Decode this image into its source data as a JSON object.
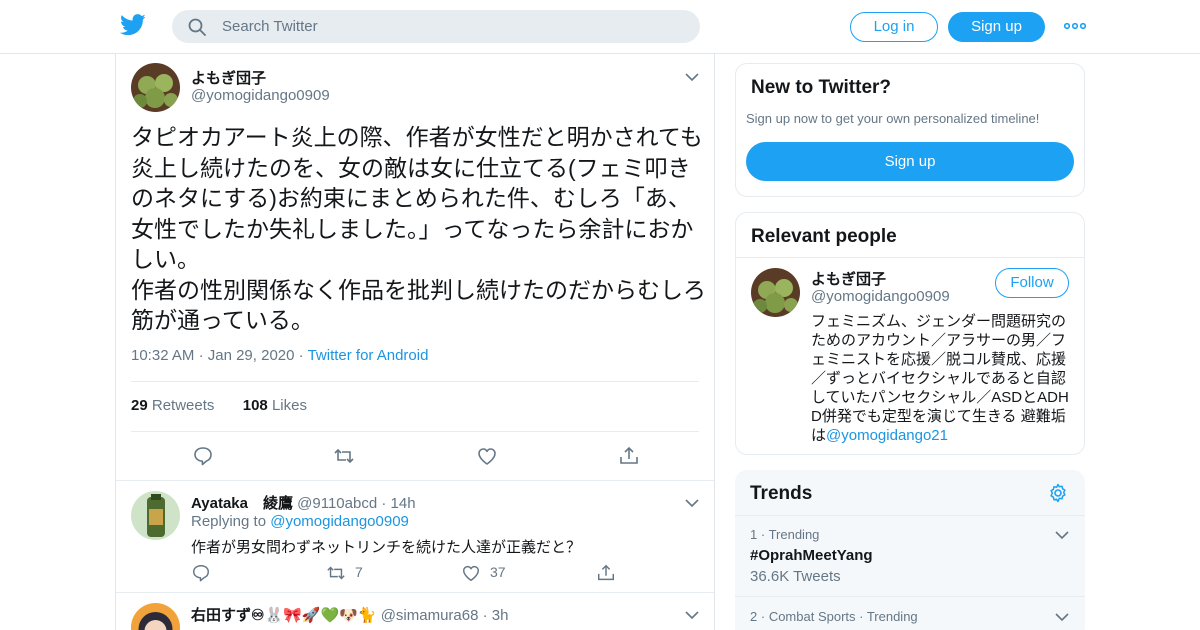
{
  "header": {
    "search_placeholder": "Search Twitter",
    "login_label": "Log in",
    "signup_label": "Sign up",
    "icons": [
      "twitter-bird-icon",
      "search-icon",
      "more-icon"
    ],
    "accent": "#1da1f2"
  },
  "tweet": {
    "name": "よもぎ団子",
    "handle": "@yomogidango0909",
    "text": "タピオカアート炎上の際、作者が女性だと明かされても炎上し続けたのを、女の敵は女に仕立てる(フェミ叩きのネタにする)お約束にまとめられた件、むしろ「あ、女性でしたか失礼しました。」ってなったら余計におかしい。\n作者の性別関係なく作品を批判し続けたのだからむしろ筋が通っている。",
    "time": "10:32 AM",
    "date": "Jan 29, 2020",
    "source": "Twitter for Android",
    "retweets_count": "29",
    "retweets_label": "Retweets",
    "likes_count": "108",
    "likes_label": "Likes"
  },
  "replies": [
    {
      "name": "Ayataka　綾鷹",
      "handle": "@9110abcd",
      "time": "14h",
      "replying_label": "Replying to",
      "replying_to": "@yomogidango0909",
      "text": "作者が男女問わずネットリンチを続けた人達が正義だと？",
      "retweets": "7",
      "likes": "37"
    },
    {
      "name": "右田すず♾🐰🎀🚀💚🐶🐈",
      "handle": "@simamura68",
      "time": "3h"
    }
  ],
  "new_to_twitter": {
    "title": "New to Twitter?",
    "subtitle": "Sign up now to get your own personalized timeline!",
    "signup_label": "Sign up"
  },
  "relevant": {
    "title": "Relevant people",
    "name": "よもぎ団子",
    "handle": "@yomogidango0909",
    "follow_label": "Follow",
    "bio": "フェミニズム、ジェンダー問題研究のためのアカウント／アラサーの男／フェミニストを応援／脱コル賛成、応援／ずっとバイセクシャルであると自認していたパンセクシャル／ASDとADHD併発でも定型を演じて生きる 避難垢は",
    "bio_link": "@yomogidango21"
  },
  "trends": {
    "title": "Trends",
    "items": [
      {
        "rank": "1",
        "context": "Trending",
        "name": "#OprahMeetYang",
        "count": "36.6K Tweets"
      },
      {
        "rank": "2",
        "context": "Combat Sports · Trending"
      }
    ]
  }
}
